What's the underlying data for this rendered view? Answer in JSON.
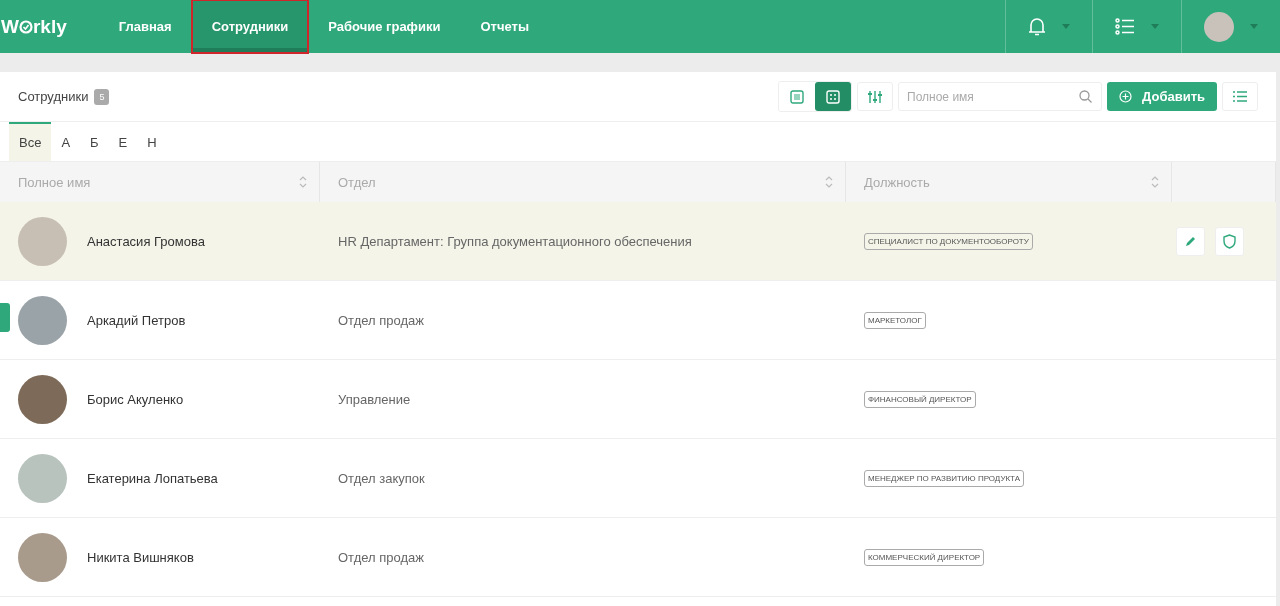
{
  "header": {
    "logo": {
      "before": "W",
      "after": "rkly"
    },
    "nav": [
      {
        "label": "Главная",
        "selected": false,
        "highlighted": false
      },
      {
        "label": "Сотрудники",
        "selected": true,
        "highlighted": true
      },
      {
        "label": "Рабочие графики",
        "selected": false,
        "highlighted": false
      },
      {
        "label": "Отчеты",
        "selected": false,
        "highlighted": false
      }
    ]
  },
  "panel": {
    "title": "Сотрудники",
    "count": "5",
    "views": [
      {
        "kind": "grid",
        "selected": false
      },
      {
        "kind": "list",
        "selected": true
      }
    ],
    "search": {
      "placeholder": "Полное имя"
    },
    "add_button": "Добавить",
    "letters": [
      {
        "label": "Все",
        "selected": true
      },
      {
        "label": "А",
        "selected": false
      },
      {
        "label": "Б",
        "selected": false
      },
      {
        "label": "Е",
        "selected": false
      },
      {
        "label": "Н",
        "selected": false
      }
    ]
  },
  "table": {
    "columns": [
      "Полное имя",
      "Отдел",
      "Должность"
    ],
    "rows": [
      {
        "name": "Анастасия Громова",
        "department": "HR Департамент: Группа документационного обеспечения",
        "position": "СПЕЦИАЛИСТ ПО ДОКУМЕНТООБОРОТУ",
        "selected": true
      },
      {
        "name": "Аркадий Петров",
        "department": "Отдел продаж",
        "position": "МАРКЕТОЛОГ",
        "selected": false
      },
      {
        "name": "Борис Акуленко",
        "department": "Управление",
        "position": "ФИНАНСОВЫЙ ДИРЕКТОР",
        "selected": false
      },
      {
        "name": "Екатерина Лопатьева",
        "department": "Отдел закупок",
        "position": "МЕНЕДЖЕР ПО РАЗВИТИЮ ПРОДУКТА",
        "selected": false
      },
      {
        "name": "Никита Вишняков",
        "department": "Отдел продаж",
        "position": "КОММЕРЧЕСКИЙ ДИРЕКТОР",
        "selected": false
      }
    ]
  }
}
